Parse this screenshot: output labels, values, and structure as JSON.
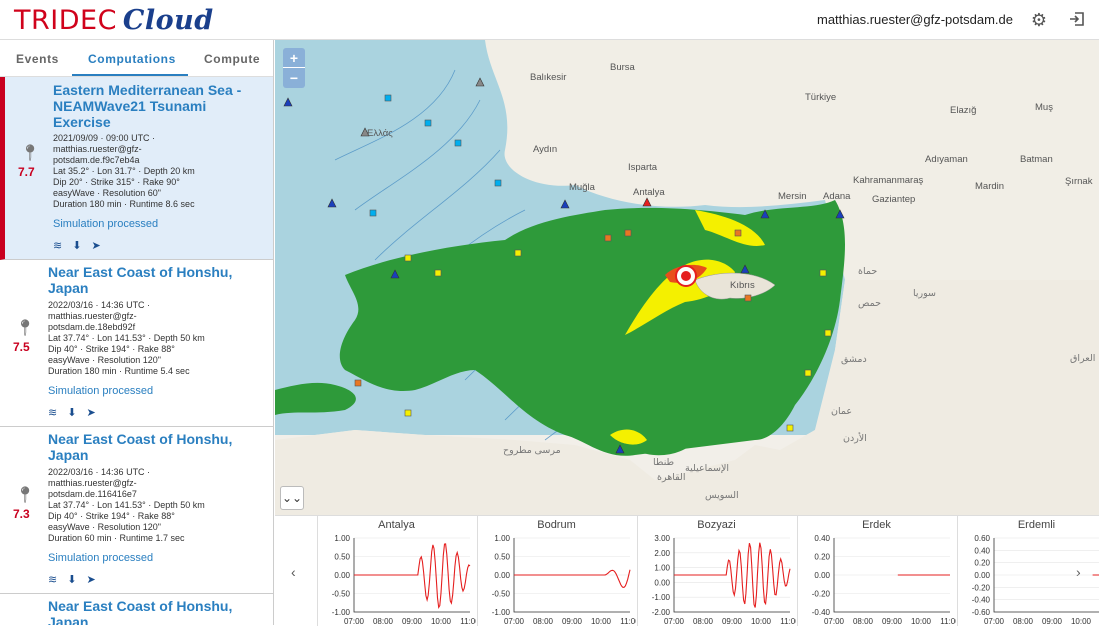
{
  "header": {
    "logo_part1": "TRIDEC",
    "logo_part2": "Cloud",
    "user_email": "matthias.ruester@gfz-potsdam.de",
    "settings_icon": "gear-icon",
    "logout_icon": "logout-icon"
  },
  "tabs": [
    "Events",
    "Computations",
    "Compute"
  ],
  "active_tab": "Computations",
  "computations": [
    {
      "title": "Eastern Mediterranean Sea - NEAMWave21 Tsunami Exercise",
      "magnitude": "7.7",
      "datetime": "2021/09/09 · 09:00 UTC ·",
      "user1": "matthias.ruester@gfz-",
      "user2": "potsdam.de.f9c7eb4a",
      "location": "Lat 35.2° · Lon 31.7° · Depth 20 km",
      "mechanism": "Dip 20° · Strike 315° · Rake 90°",
      "model": "easyWave · Resolution 60\"",
      "duration": "Duration 180 min · Runtime 8.6 sec",
      "status": "Simulation processed"
    },
    {
      "title": "Near East Coast of Honshu, Japan",
      "magnitude": "7.5",
      "datetime": "2022/03/16 · 14:36 UTC ·",
      "user1": "matthias.ruester@gfz-",
      "user2": "potsdam.de.18ebd92f",
      "location": "Lat 37.74° · Lon 141.53° · Depth 50 km",
      "mechanism": "Dip 40° · Strike 194° · Rake 88°",
      "model": "easyWave · Resolution 120\"",
      "duration": "Duration 180 min · Runtime 5.4 sec",
      "status": "Simulation processed"
    },
    {
      "title": "Near East Coast of Honshu, Japan",
      "magnitude": "7.3",
      "datetime": "2022/03/16 · 14:36 UTC ·",
      "user1": "matthias.ruester@gfz-",
      "user2": "potsdam.de.116416e7",
      "location": "Lat 37.74° · Lon 141.53° · Depth 50 km",
      "mechanism": "Dip 40° · Strike 194° · Rake 88°",
      "model": "easyWave · Resolution 120\"",
      "duration": "Duration 60 min · Runtime 1.7 sec",
      "status": "Simulation processed"
    },
    {
      "title": "Near East Coast of Honshu, Japan"
    }
  ],
  "map": {
    "zoom_in": "+",
    "zoom_out": "−",
    "labels": {
      "balikesir": "Balıkesir",
      "bursa": "Bursa",
      "turkiye": "Türkiye",
      "elazig": "Elazığ",
      "mus": "Muş",
      "aydin": "Aydın",
      "mugla": "Muğla",
      "isparta": "Isparta",
      "antalya": "Antalya",
      "mersin": "Mersin",
      "adana": "Adana",
      "gaziantep": "Gaziantep",
      "adiyaman": "Adıyaman",
      "batman": "Batman",
      "mardin": "Mardin",
      "sirnak": "Şırnak",
      "kibris": "Kıbrıs",
      "ellas": "Ελλάς",
      "karamanmaras": "Kahramanmaraş",
      "suria": "سوريا",
      "iraq": "العراق",
      "homs": "حمص",
      "dimashq": "دمشق",
      "amman": "عمان",
      "urdun": "الأردن",
      "qahira": "القاهرة",
      "suways": "السويس",
      "ismailia": "الإسماعيلية",
      "tanta": "طنطا",
      "hama": "حماة",
      "marsa_matruh": "مرسى مطروح"
    }
  },
  "gauges": [
    {
      "name": "Antalya",
      "yticks": [
        "1.00",
        "0.50",
        "0.00",
        "-0.50",
        "-1.00"
      ]
    },
    {
      "name": "Bodrum",
      "yticks": [
        "1.00",
        "0.50",
        "0.00",
        "-0.50",
        "-1.00"
      ]
    },
    {
      "name": "Bozyazi",
      "yticks": [
        "3.00",
        "2.00",
        "1.00",
        "0.00",
        "-1.00",
        "-2.00"
      ]
    },
    {
      "name": "Erdek",
      "yticks": [
        "0.40",
        "0.20",
        "0.00",
        "-0.20",
        "-0.40"
      ]
    },
    {
      "name": "Erdemli",
      "yticks": [
        "0.60",
        "0.40",
        "0.20",
        "0.00",
        "-0.20",
        "-0.40",
        "-0.60"
      ]
    }
  ],
  "gauge_xticks": [
    "07:00",
    "08:00",
    "09:00",
    "10:00",
    "11:00"
  ],
  "colors": {
    "accent": "#2a7fc0",
    "alert": "#c9001f",
    "green_zone": "#2e9a3a",
    "yellow_zone": "#f4f000",
    "sea": "#aad3df"
  }
}
